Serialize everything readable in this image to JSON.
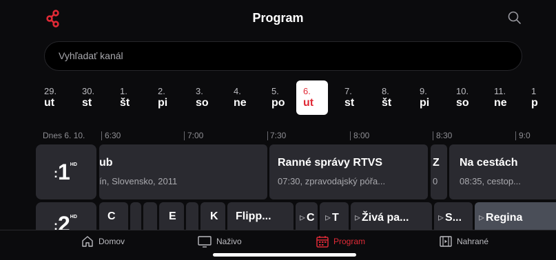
{
  "header": {
    "title": "Program",
    "icons": [
      "share-logo-icon",
      "search-icon"
    ],
    "accent": "#e02a36"
  },
  "search": {
    "placeholder": "Vyhľadať kanál"
  },
  "dates": [
    {
      "num": "29.",
      "day": "ut"
    },
    {
      "num": "30.",
      "day": "st"
    },
    {
      "num": "1.",
      "day": "št"
    },
    {
      "num": "2.",
      "day": "pi"
    },
    {
      "num": "3.",
      "day": "so"
    },
    {
      "num": "4.",
      "day": "ne"
    },
    {
      "num": "5.",
      "day": "po"
    },
    {
      "num": "6.",
      "day": "ut",
      "selected": true
    },
    {
      "num": "7.",
      "day": "st"
    },
    {
      "num": "8.",
      "day": "št"
    },
    {
      "num": "9.",
      "day": "pi"
    },
    {
      "num": "10.",
      "day": "so"
    },
    {
      "num": "11.",
      "day": "ne"
    },
    {
      "num": "1",
      "day": "p"
    }
  ],
  "timeline": {
    "today": "Dnes 6. 10.",
    "times": [
      "6:30",
      "7:00",
      "7:30",
      "8:00",
      "8:30",
      "9:0"
    ]
  },
  "channels": [
    {
      "logo": "1",
      "hd": "HD",
      "programs": [
        {
          "title": "ub",
          "sub": "ín, Slovensko, 2011"
        },
        {
          "title": "Ranné správy RTVS",
          "sub": "07:30, zpravodajský póřa..."
        },
        {
          "title": "Z",
          "sub": "0"
        },
        {
          "title": "Na cestách",
          "sub": "08:35, cestop..."
        }
      ]
    },
    {
      "logo": "2",
      "hd": "HD",
      "programs": [
        {
          "title": "C",
          "tri": false
        },
        {
          "title": "",
          "tri": false
        },
        {
          "title": "",
          "tri": false
        },
        {
          "title": "E",
          "tri": false
        },
        {
          "title": "",
          "tri": false
        },
        {
          "title": "K",
          "tri": false
        },
        {
          "title": "Flipp...",
          "tri": false
        },
        {
          "title": "C",
          "tri": true
        },
        {
          "title": "T",
          "tri": true
        },
        {
          "title": "Živá pa...",
          "tri": true
        },
        {
          "title": "S...",
          "tri": true
        },
        {
          "title": "Regina",
          "tri": true
        }
      ]
    }
  ],
  "tabs": [
    {
      "label": "Domov",
      "icon": "home-icon"
    },
    {
      "label": "Naživo",
      "icon": "monitor-icon"
    },
    {
      "label": "Program",
      "icon": "calendar-icon",
      "active": true
    },
    {
      "label": "Nahrané",
      "icon": "film-icon"
    }
  ]
}
